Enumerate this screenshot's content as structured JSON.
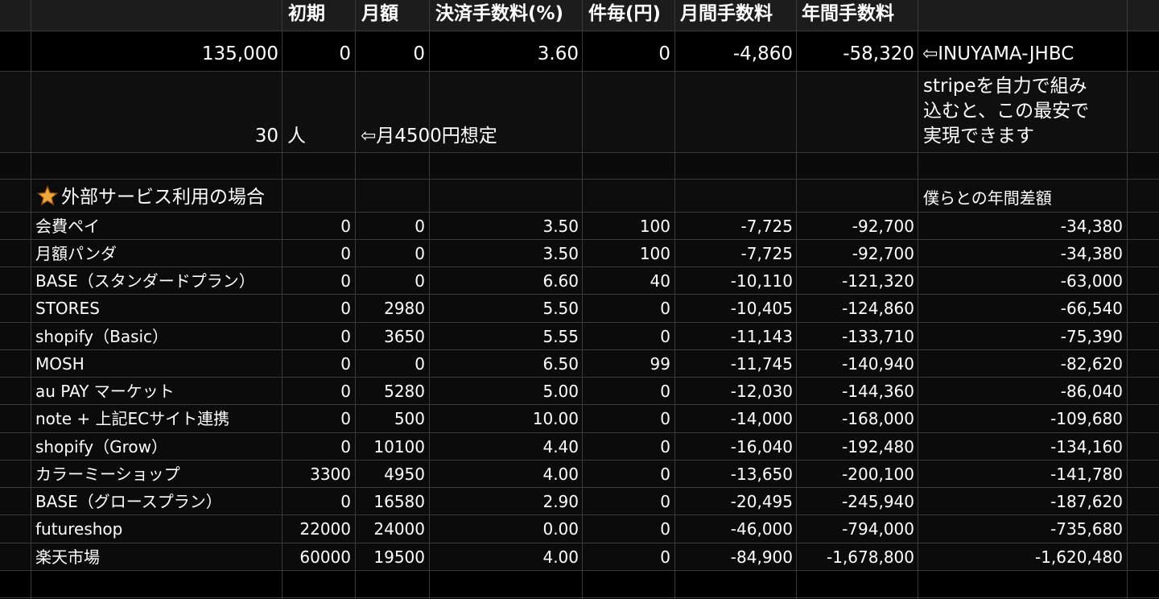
{
  "header": {
    "col_initial": "初期",
    "col_monthly": "月額",
    "col_fee_pct": "決済手数料(%)",
    "col_per_item": "件毎(円)",
    "col_monthly_fee": "月間手数料",
    "col_annual_fee": "年間手数料"
  },
  "summary": {
    "amount": "135,000",
    "initial": "0",
    "monthly": "0",
    "fee_pct": "3.60",
    "per_item": "0",
    "monthly_fee": "-4,860",
    "annual_fee": "-58,320",
    "note": "⇦INUYAMA-JHBC"
  },
  "people": {
    "count": "30",
    "unit": "人",
    "assumption": "⇦月4500円想定",
    "stripe_note_1": "stripeを自力で組み",
    "stripe_note_2": "込むと、この最安で",
    "stripe_note_3": "実現できます"
  },
  "section": {
    "title": "外部サービス利用の場合",
    "diff_label": "僕らとの年間差額",
    "icon": "star-icon"
  },
  "services": [
    {
      "name": "会費ペイ",
      "initial": "0",
      "monthly": "0",
      "fee": "3.50",
      "per": "100",
      "mfee": "-7,725",
      "afee": "-92,700",
      "diff": "-34,380"
    },
    {
      "name": "月額パンダ",
      "initial": "0",
      "monthly": "0",
      "fee": "3.50",
      "per": "100",
      "mfee": "-7,725",
      "afee": "-92,700",
      "diff": "-34,380"
    },
    {
      "name": "BASE（スタンダードプラン）",
      "initial": "0",
      "monthly": "0",
      "fee": "6.60",
      "per": "40",
      "mfee": "-10,110",
      "afee": "-121,320",
      "diff": "-63,000"
    },
    {
      "name": "STORES",
      "initial": "0",
      "monthly": "2980",
      "fee": "5.50",
      "per": "0",
      "mfee": "-10,405",
      "afee": "-124,860",
      "diff": "-66,540"
    },
    {
      "name": "shopify（Basic）",
      "initial": "0",
      "monthly": "3650",
      "fee": "5.55",
      "per": "0",
      "mfee": "-11,143",
      "afee": "-133,710",
      "diff": "-75,390"
    },
    {
      "name": "MOSH",
      "initial": "0",
      "monthly": "0",
      "fee": "6.50",
      "per": "99",
      "mfee": "-11,745",
      "afee": "-140,940",
      "diff": "-82,620"
    },
    {
      "name": "au PAY マーケット",
      "initial": "0",
      "monthly": "5280",
      "fee": "5.00",
      "per": "0",
      "mfee": "-12,030",
      "afee": "-144,360",
      "diff": "-86,040"
    },
    {
      "name": "note + 上記ECサイト連携",
      "initial": "0",
      "monthly": "500",
      "fee": "10.00",
      "per": "0",
      "mfee": "-14,000",
      "afee": "-168,000",
      "diff": "-109,680"
    },
    {
      "name": "shopify（Grow）",
      "initial": "0",
      "monthly": "10100",
      "fee": "4.40",
      "per": "0",
      "mfee": "-16,040",
      "afee": "-192,480",
      "diff": "-134,160"
    },
    {
      "name": "カラーミーショップ",
      "initial": "3300",
      "monthly": "4950",
      "fee": "4.00",
      "per": "0",
      "mfee": "-13,650",
      "afee": "-200,100",
      "diff": "-141,780"
    },
    {
      "name": "BASE（グロースプラン）",
      "initial": "0",
      "monthly": "16580",
      "fee": "2.90",
      "per": "0",
      "mfee": "-20,495",
      "afee": "-245,940",
      "diff": "-187,620"
    },
    {
      "name": "futureshop",
      "initial": "22000",
      "monthly": "24000",
      "fee": "0.00",
      "per": "0",
      "mfee": "-46,000",
      "afee": "-794,000",
      "diff": "-735,680"
    },
    {
      "name": "楽天市場",
      "initial": "60000",
      "monthly": "19500",
      "fee": "4.00",
      "per": "0",
      "mfee": "-84,900",
      "afee": "-1,678,800",
      "diff": "-1,620,480"
    }
  ]
}
